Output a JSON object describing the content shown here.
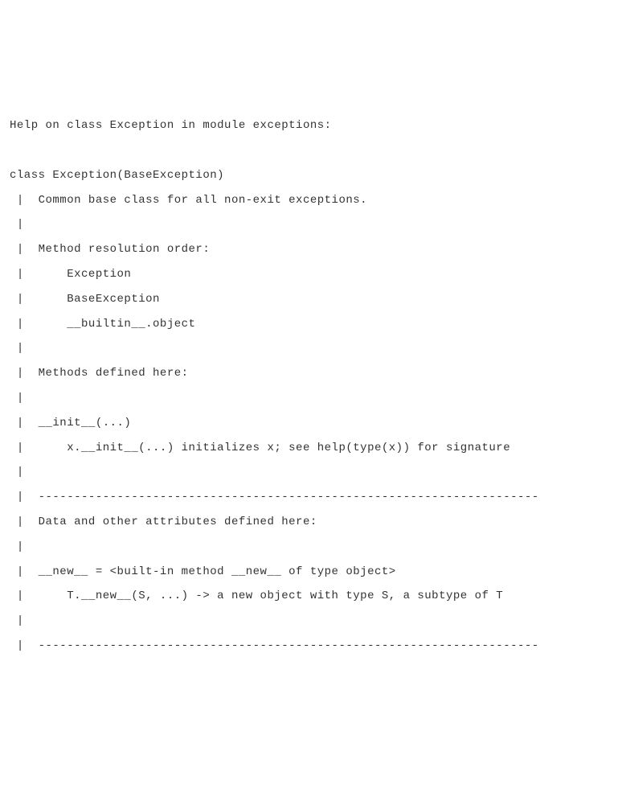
{
  "lines": [
    "Help on class Exception in module exceptions:",
    "",
    "class Exception(BaseException)",
    " |  Common base class for all non-exit exceptions.",
    " |",
    " |  Method resolution order:",
    " |      Exception",
    " |      BaseException",
    " |      __builtin__.object",
    " |",
    " |  Methods defined here:",
    " |",
    " |  __init__(...)",
    " |      x.__init__(...) initializes x; see help(type(x)) for signature",
    " |",
    " |  ----------------------------------------------------------------------",
    " |  Data and other attributes defined here:",
    " |",
    " |  __new__ = <built-in method __new__ of type object>",
    " |      T.__new__(S, ...) -> a new object with type S, a subtype of T",
    " |",
    " |  ----------------------------------------------------------------------"
  ]
}
